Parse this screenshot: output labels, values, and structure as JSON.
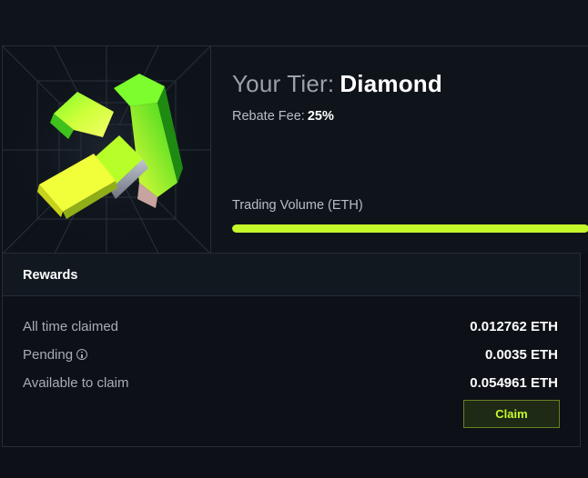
{
  "tier": {
    "title_prefix": "Your Tier:",
    "name": "Diamond",
    "rebate_label": "Rebate Fee:",
    "rebate_value": "25%",
    "volume_label": "Trading Volume (ETH)",
    "volume_progress_fraction": 1.0,
    "accent_color": "#c5f82a",
    "badge_icon": "up-arrow-badge-icon"
  },
  "rewards": {
    "title": "Rewards",
    "rows": [
      {
        "label": "All time claimed",
        "value": "0.012762 ETH"
      },
      {
        "label": "Pending",
        "value": "0.0035 ETH",
        "icon": "info-icon"
      },
      {
        "label": "Available to claim",
        "value": "0.054961 ETH"
      }
    ],
    "claim_label": "Claim"
  }
}
